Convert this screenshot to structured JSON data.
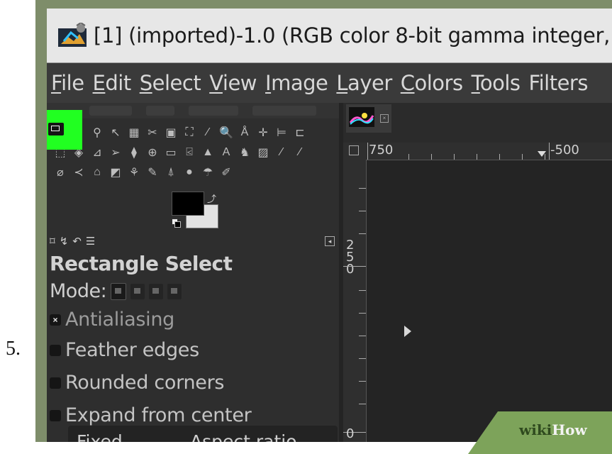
{
  "step": {
    "number": "5."
  },
  "window": {
    "title": "[1] (imported)-1.0 (RGB color 8-bit gamma integer,"
  },
  "menubar": {
    "items": [
      {
        "label": "File",
        "accel": "F",
        "rest": "ile"
      },
      {
        "label": "Edit",
        "accel": "E",
        "rest": "dit"
      },
      {
        "label": "Select",
        "accel": "S",
        "rest": "elect"
      },
      {
        "label": "View",
        "accel": "V",
        "rest": "iew"
      },
      {
        "label": "Image",
        "accel": "I",
        "rest": "mage"
      },
      {
        "label": "Layer",
        "accel": "L",
        "rest": "ayer"
      },
      {
        "label": "Colors",
        "accel": "C",
        "rest": "olors"
      },
      {
        "label": "Tools",
        "accel": "T",
        "rest": "ools"
      },
      {
        "label": "Filters",
        "accel": "",
        "rest": "Filters"
      }
    ]
  },
  "toolbox": {
    "active_tool_icon": "rectangle-select-icon",
    "rows": [
      [
        "",
        "◌",
        "⚲",
        "↖",
        "▦",
        "✂",
        "▣",
        "⛶",
        "⁄",
        "🔍",
        "Å",
        "✛",
        "⊨",
        "⊏"
      ],
      [
        "⬚",
        "◈",
        "⊿",
        "➢",
        "⧫",
        "⊕",
        "▭",
        "⍃",
        "▲",
        "A",
        "♞",
        "▨",
        "∕",
        "∕"
      ],
      [
        "⌀",
        "≺",
        "⌂",
        "◩",
        "⚘",
        "✎",
        "⍋",
        "●",
        "☂",
        "✐"
      ]
    ],
    "colors": {
      "foreground": "#000000",
      "background": "#e2e2e2"
    }
  },
  "tool_options": {
    "tabs": [
      "⌑",
      "↯",
      "↶",
      "☰"
    ],
    "tool_name": "Rectangle Select",
    "mode_label": "Mode:",
    "options": [
      {
        "label": "Antialiasing",
        "checked": true,
        "enabled": false
      },
      {
        "label": "Feather edges",
        "checked": false,
        "enabled": true
      },
      {
        "label": "Rounded corners",
        "checked": false,
        "enabled": true
      },
      {
        "label": "Expand from center",
        "checked": false,
        "enabled": true
      }
    ],
    "fixed": {
      "label": "Fixed",
      "dropdown_value": "Aspect ratio"
    }
  },
  "rulers": {
    "top_labels": [
      "750",
      "-500"
    ],
    "left_labels": [
      "2",
      "5",
      "0"
    ],
    "bottom_label": "0"
  },
  "watermark": {
    "wiki": "wiki",
    "how": "How"
  },
  "colors": {
    "highlight": "#21ff21",
    "frame": "#7e8d6a",
    "panel": "#2e2e2e",
    "watermark": "#7da35a"
  }
}
